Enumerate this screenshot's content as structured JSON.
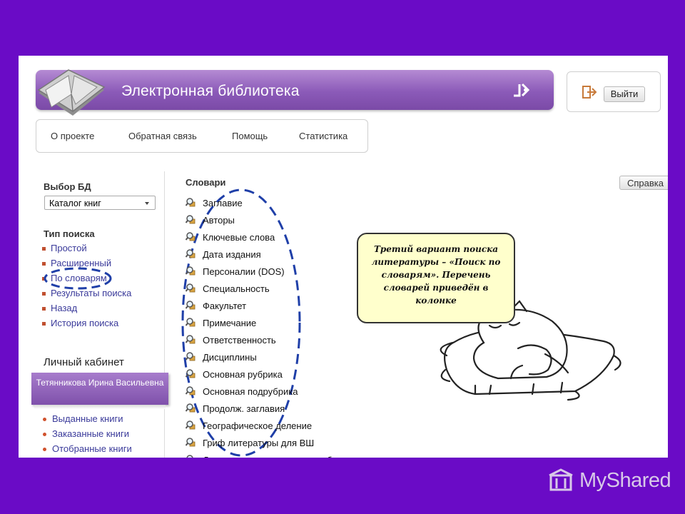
{
  "app": {
    "title": "Электронная библиотека"
  },
  "header": {
    "logout_label": "Выйти",
    "logout_icon": "logout-icon",
    "logo_icon": "open-book-icon"
  },
  "nav": {
    "items": [
      "О проекте",
      "Обратная связь",
      "Помощь",
      "Статистика"
    ]
  },
  "sidebar": {
    "db_title": "Выбор БД",
    "db_selected": "Каталог книг",
    "search_type_title": "Тип поиска",
    "search_types": [
      "Простой",
      "Расширенный",
      "По словарям",
      "Результаты поиска",
      "Назад",
      "История поиска"
    ],
    "cabinet_title": "Личный кабинет",
    "user_name": "Тетянникова Ирина Васильевна",
    "cabinet_items": [
      "Выданные книги",
      "Заказанные книги",
      "Отобранные книги"
    ]
  },
  "dictionaries": {
    "title": "Словари",
    "items": [
      "Заглавие",
      "Авторы",
      "Ключевые слова",
      "Дата издания",
      "Персоналии (DOS)",
      "Специальность",
      "Факультет",
      "Примечание",
      "Ответственность",
      "Дисциплины",
      "Основная рубрика",
      "Основная подрубрика",
      "Продолж. заглавия",
      "Географическое деление",
      "Гриф литературы для ВШ",
      "Дополнительные сведения об издании"
    ]
  },
  "help": {
    "label": "Справка"
  },
  "callout": {
    "text": "Третий вариант поиска литературы – «Поиск по словарям». Перечень словарей приведён в колонке"
  },
  "watermark": {
    "text": "MyShared"
  },
  "colors": {
    "background": "#6a0bc6",
    "header": "#8b5ab8",
    "annotation": "#1f3fa8",
    "callout": "#ffffcc"
  }
}
